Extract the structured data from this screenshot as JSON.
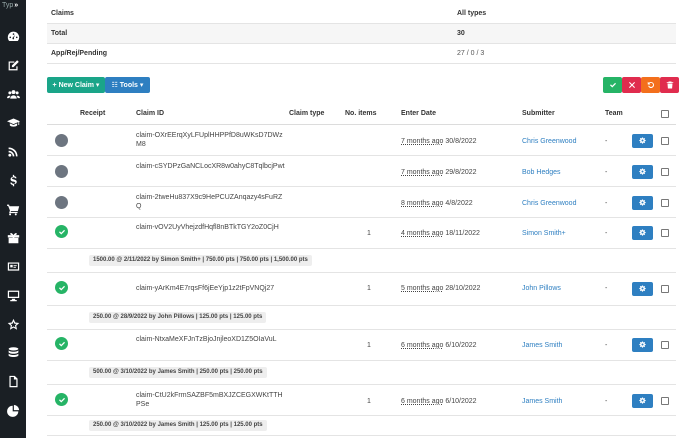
{
  "sidebar": {
    "top_label": "Typ",
    "top_arrow": "»",
    "icons": [
      "dashboard-icon",
      "edit-icon",
      "users-icon",
      "graduation-cap-icon",
      "rss-icon",
      "dollar-icon",
      "cart-icon",
      "gift-icon",
      "id-card-icon",
      "monitor-icon",
      "star-icon",
      "database-icon",
      "document-icon",
      "pie-chart-icon"
    ]
  },
  "summary": [
    {
      "label": "Claims",
      "value": "All types"
    },
    {
      "label": "Total",
      "value": "30"
    },
    {
      "label": "App/Rej/Pending",
      "value": "27 / 0 / 3"
    }
  ],
  "toolbar": {
    "new_claim_label": "+ New Claim ▾",
    "tools_label": "☷ Tools ▾"
  },
  "table": {
    "headers": {
      "receipt": "Receipt",
      "claim_id": "Claim ID",
      "claim_type": "Claim type",
      "num_items": "No. items",
      "enter_date": "Enter Date",
      "submitter": "Submitter",
      "team": "Team"
    },
    "rows": [
      {
        "status": "pending",
        "claim_id": "claim-OXrEErqXyLFUplHHPPfD8uWKsD7DWzM8",
        "items": "",
        "ago": "7 months ago",
        "date": "30/8/2022",
        "submitter": "Chris Greenwood",
        "team": "-",
        "detail": ""
      },
      {
        "status": "pending",
        "claim_id": "claim-cSYDPzGaNCLocXR8w0ahyC8TqlbcjPwt",
        "items": "",
        "ago": "7 months ago",
        "date": "29/8/2022",
        "submitter": "Bob Hedges",
        "team": "-",
        "detail": ""
      },
      {
        "status": "pending",
        "claim_id": "claim-2tweHu837X9c9HePCUZAnqazy4sFuRZQ",
        "items": "",
        "ago": "8 months ago",
        "date": "4/8/2022",
        "submitter": "Chris Greenwood",
        "team": "-",
        "detail": ""
      },
      {
        "status": "approved",
        "claim_id": "claim-vOV2UyVhejzdfHqfl8nBTkTGY2oZ0CjH",
        "items": "1",
        "ago": "4 months ago",
        "date": "18/11/2022",
        "submitter": "Simon Smith+",
        "team": "-",
        "detail": "1500.00 @ 2/11/2022 by Simon Smith+ | 750.00 pts | 750.00 pts | 1,500.00 pts"
      },
      {
        "status": "approved",
        "claim_id": "claim-yArKm4E7rqsFf6jEeYjp1z2tFpVNQj27",
        "items": "1",
        "ago": "5 months ago",
        "date": "28/10/2022",
        "submitter": "John Pillows",
        "team": "-",
        "detail": "250.00 @ 28/9/2022 by John Pillows | 125.00 pts | 125.00 pts"
      },
      {
        "status": "approved",
        "claim_id": "claim-NtxaMeXFJnTzBjoJnjleoXD1Z5OIaVuL",
        "items": "1",
        "ago": "6 months ago",
        "date": "6/10/2022",
        "submitter": "James Smith",
        "team": "-",
        "detail": "500.00 @ 3/10/2022 by James Smith | 250.00 pts | 250.00 pts"
      },
      {
        "status": "approved",
        "claim_id": "claim-CtU2kFrmSAZBF5mBXJZCEGXWKtTTHPSe",
        "items": "1",
        "ago": "6 months ago",
        "date": "6/10/2022",
        "submitter": "James Smith",
        "team": "-",
        "detail": "250.00 @ 3/10/2022 by James Smith | 125.00 pts | 125.00 pts"
      }
    ]
  },
  "colors": {
    "sidebar_bg": "#1a1f24",
    "new_claim": "#1aa589",
    "tools": "#2e7fc1",
    "approve": "#26b466",
    "reject": "#e02c4e",
    "undo": "#f36f1c",
    "link": "#2e7fc1"
  }
}
